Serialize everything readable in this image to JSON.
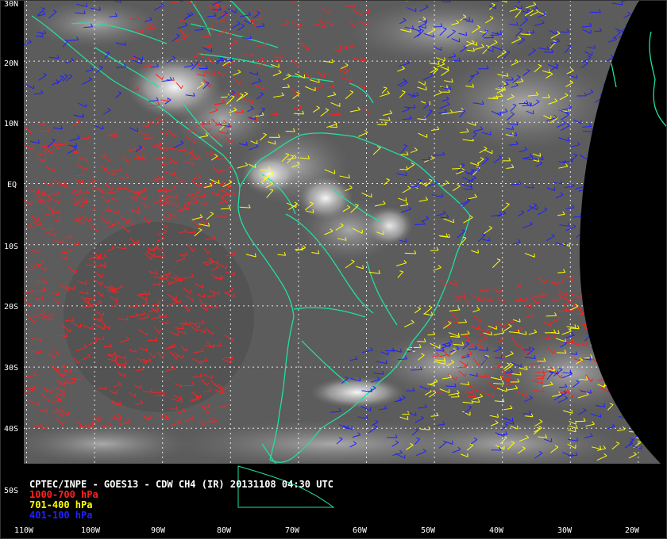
{
  "map": {
    "lat_labels": [
      "30N",
      "20N",
      "10N",
      "EQ",
      "10S",
      "20S",
      "30S",
      "40S",
      "50S"
    ],
    "lon_labels": [
      "110W",
      "100W",
      "90W",
      "80W",
      "70W",
      "60W",
      "50W",
      "40W",
      "30W",
      "20W"
    ],
    "caption": {
      "title": "CPTEC/INPE - GOES13 - CDW CH4 (IR) 20131108 04:30 UTC",
      "layers": [
        {
          "label": "1000-700 hPa",
          "color": "#ff2020"
        },
        {
          "label": "701-400 hPa",
          "color": "#ffff00"
        },
        {
          "label": "401-100 hPa",
          "color": "#2020ff"
        }
      ]
    },
    "colors": {
      "background": "#000000",
      "earth_disk": "#5c5c5c",
      "coastline": "#20e0a0",
      "grid": "#ffffff",
      "low_wind": "#ff2020",
      "mid_wind": "#ffff00",
      "high_wind": "#2020ff"
    },
    "wind_regions": [
      {
        "layer": "low",
        "lat": [
          -40,
          10
        ],
        "lon": [
          -110,
          -80
        ],
        "count": 420
      },
      {
        "layer": "low",
        "lat": [
          -35,
          -15
        ],
        "lon": [
          -50,
          -15
        ],
        "count": 160
      },
      {
        "layer": "low",
        "lat": [
          10,
          30
        ],
        "lon": [
          -95,
          -60
        ],
        "count": 90
      },
      {
        "layer": "mid",
        "lat": [
          -45,
          -20
        ],
        "lon": [
          -55,
          -20
        ],
        "count": 130
      },
      {
        "layer": "mid",
        "lat": [
          -15,
          20
        ],
        "lon": [
          -85,
          -30
        ],
        "count": 170
      },
      {
        "layer": "mid",
        "lat": [
          15,
          30
        ],
        "lon": [
          -55,
          -30
        ],
        "count": 40
      },
      {
        "layer": "high",
        "lat": [
          -10,
          30
        ],
        "lon": [
          -55,
          -20
        ],
        "count": 230
      },
      {
        "layer": "high",
        "lat": [
          -45,
          -25
        ],
        "lon": [
          -65,
          -20
        ],
        "count": 110
      },
      {
        "layer": "high",
        "lat": [
          5,
          30
        ],
        "lon": [
          -110,
          -75
        ],
        "count": 90
      }
    ]
  }
}
